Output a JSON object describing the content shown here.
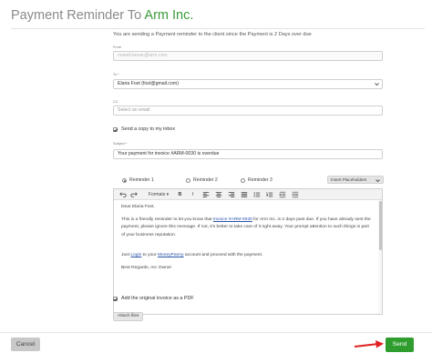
{
  "header": {
    "title_prefix": "Payment Reminder To",
    "client_name": "Arm Inc."
  },
  "form": {
    "notice": "You are sending a Payment reminder to the client since the Payment is 2 Days over due",
    "from": {
      "label": "From",
      "value": "nowell.lamar@arm.com"
    },
    "to": {
      "label": "To *",
      "value": "Elaria Fost (fost@gmail.com)"
    },
    "cc": {
      "label": "CC",
      "placeholder": "Select an email"
    },
    "send_copy": {
      "label": "Send a copy to my inbox",
      "checked": true
    },
    "subject": {
      "label": "Subject *",
      "value": "Your payment for invoice #ARM-0030 is overdue"
    },
    "reminders": [
      {
        "label": "Reminder 1",
        "selected": true
      },
      {
        "label": "Reminder 2",
        "selected": false
      },
      {
        "label": "Reminder 3",
        "selected": false
      }
    ],
    "insert_placeholders_label": "Insert Placeholders",
    "attach_pdf": {
      "label": "Add the original invoice as a PDF",
      "checked": true
    },
    "attach_files_label": "Attach files"
  },
  "editor": {
    "toolbar": {
      "undo_icon": "undo-icon",
      "redo_icon": "redo-icon",
      "formats_label": "Formats",
      "bold_label": "B",
      "italic_label": "I"
    },
    "body": {
      "greeting": "Dear Elaria Fost,",
      "p1_before": "This is a friendly reminder to let you know that ",
      "p1_link": "Invoice #ARM-0030",
      "p1_after": " for Arm Inc. is 2 days past due. If you have already sent the payment, please ignore this message. If not, it's better to take care of it right away. Your prompt attention to such things is part of your business reputation.",
      "p2_before": "Just ",
      "p2_link1": "Login",
      "p2_mid": " to your ",
      "p2_link2": "MoneyPanny",
      "p2_after": " account and proceed with the payment.",
      "signoff": "Best Regards, Arc Owner"
    }
  },
  "footer": {
    "cancel_label": "Cancel",
    "send_label": "Send"
  },
  "colors": {
    "brand_green": "#2e9d2e",
    "title_gray": "#8a8a8a",
    "arrow_red": "#e02020",
    "link_blue": "#2a53a8"
  }
}
